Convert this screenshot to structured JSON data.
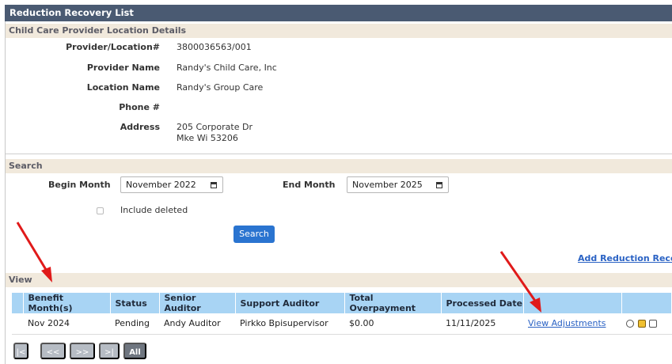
{
  "window": {
    "title": "Reduction Recovery List"
  },
  "provider_section": {
    "heading": "Child Care Provider Location Details",
    "fields": [
      {
        "label": "Provider/Location#",
        "value": "3800036563/001"
      },
      {
        "label": "Provider Name",
        "value": "Randy's Child Care, Inc"
      },
      {
        "label": "Location Name",
        "value": "Randy's Group Care"
      },
      {
        "label": "Phone #",
        "value": ""
      },
      {
        "label": "Address",
        "value": "205 Corporate Dr",
        "value2": "Mke Wi 53206"
      }
    ]
  },
  "search": {
    "heading": "Search",
    "begin_label": "Begin Month",
    "begin_value": "November 2022",
    "end_label": "End Month",
    "end_value": "November 2025",
    "include_deleted_label": "Include deleted",
    "button_label": "Search"
  },
  "add_link_label": "Add Reduction Recovery",
  "view": {
    "heading": "View",
    "columns": [
      "Benefit Month(s)",
      "Status",
      "Senior Auditor",
      "Support Auditor",
      "Total Overpayment",
      "Processed Date",
      "",
      ""
    ],
    "rows": [
      {
        "benefit_month": "Nov 2024",
        "status": "Pending",
        "senior_auditor": "Andy Auditor",
        "support_auditor": "Pirkko Bpisupervisor",
        "total_overpayment": "$0.00",
        "processed_date": "11/11/2025",
        "link_label": "View Adjustments"
      }
    ]
  },
  "pager": {
    "first": "|<",
    "prev": "<<",
    "next": ">>",
    "last": ">|",
    "all": "All"
  },
  "colors": {
    "title_bar": "#4a5a72",
    "section_bg": "#f1e9dc",
    "header_bg": "#a8d4f4",
    "accent": "#2a74d0",
    "annotation": "#e01a1a"
  }
}
